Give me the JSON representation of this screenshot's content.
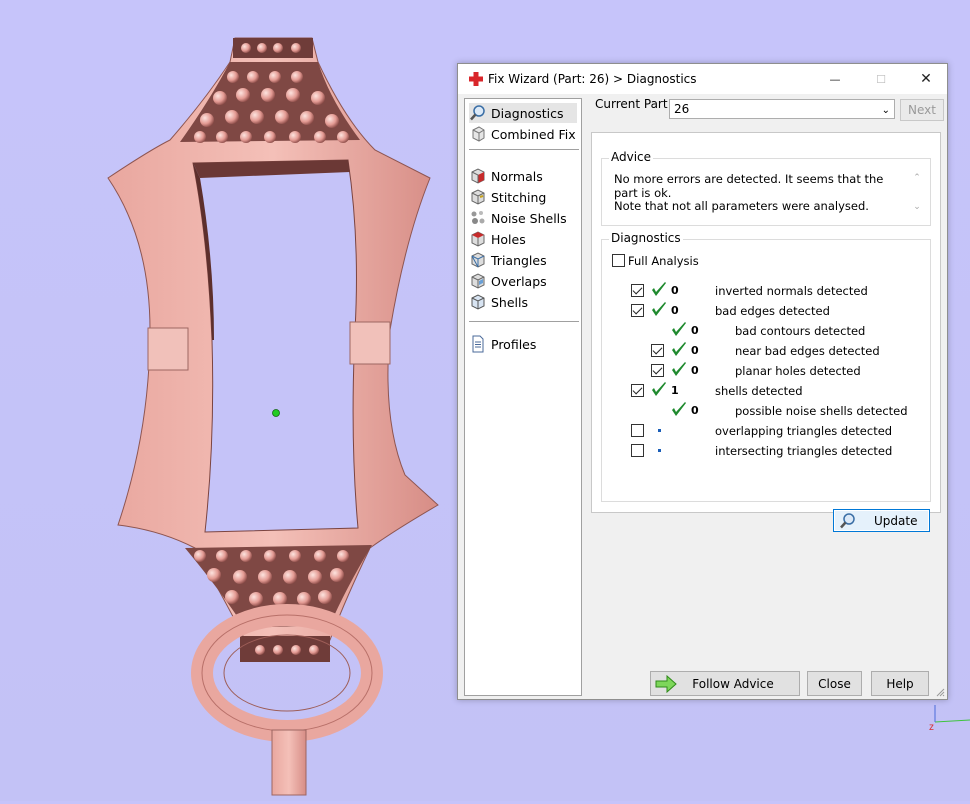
{
  "dialog": {
    "title": "Fix Wizard (Part: 26) > Diagnostics",
    "window_buttons": {
      "minimize": "—",
      "maximize": "☐",
      "close": "✕"
    },
    "nav": {
      "items": [
        {
          "label": "Diagnostics",
          "icon": "magnifier-icon",
          "selected": true
        },
        {
          "label": "Combined Fix",
          "icon": "combined-fix-icon"
        },
        {
          "label": "Normals",
          "icon": "normals-cube-icon"
        },
        {
          "label": "Stitching",
          "icon": "stitching-cube-icon"
        },
        {
          "label": "Noise Shells",
          "icon": "noise-shells-icon"
        },
        {
          "label": "Holes",
          "icon": "holes-cube-icon"
        },
        {
          "label": "Triangles",
          "icon": "triangles-cube-icon"
        },
        {
          "label": "Overlaps",
          "icon": "overlaps-cube-icon"
        },
        {
          "label": "Shells",
          "icon": "shells-cube-icon"
        },
        {
          "label": "Profiles",
          "icon": "profiles-document-icon"
        }
      ]
    },
    "current_part_label": "Current Part:",
    "current_part_value": "26",
    "next_label": "Next",
    "advice": {
      "title": "Advice",
      "text_line1": "No more errors are detected. It seems that the part is ok.",
      "text_line2": "Note that not all parameters were analysed."
    },
    "diagnostics": {
      "title": "Diagnostics",
      "full_analysis_label": "Full Analysis",
      "full_analysis_checked": false,
      "rows": [
        {
          "checkbox": true,
          "checked": true,
          "ok": true,
          "count": "0",
          "label": "inverted normals detected",
          "indent": 0
        },
        {
          "checkbox": true,
          "checked": true,
          "ok": true,
          "count": "0",
          "label": "bad edges detected",
          "indent": 0
        },
        {
          "checkbox": false,
          "checked": false,
          "ok": true,
          "count": "0",
          "label": "bad contours detected",
          "indent": 1
        },
        {
          "checkbox": true,
          "checked": true,
          "ok": true,
          "count": "0",
          "label": "near bad edges detected",
          "indent": 1
        },
        {
          "checkbox": true,
          "checked": true,
          "ok": true,
          "count": "0",
          "label": "planar holes detected",
          "indent": 1
        },
        {
          "checkbox": true,
          "checked": true,
          "ok": true,
          "count": "1",
          "label": "shells detected",
          "indent": 0
        },
        {
          "checkbox": false,
          "checked": false,
          "ok": true,
          "count": "0",
          "label": "possible noise shells detected",
          "indent": 1
        },
        {
          "checkbox": true,
          "checked": false,
          "ok": false,
          "count": "",
          "label": "overlapping triangles detected",
          "indent": 0
        },
        {
          "checkbox": true,
          "checked": false,
          "ok": false,
          "count": "",
          "label": "intersecting triangles detected",
          "indent": 0
        }
      ],
      "update_label": "Update"
    },
    "buttons": {
      "follow_advice": "Follow Advice",
      "close": "Close",
      "help": "Help"
    }
  },
  "colors": {
    "viewport_bg": "#c5c3f8",
    "model": "#e9a79f",
    "tick_green": "#1f8a2e",
    "accent_blue": "#0078d7"
  }
}
